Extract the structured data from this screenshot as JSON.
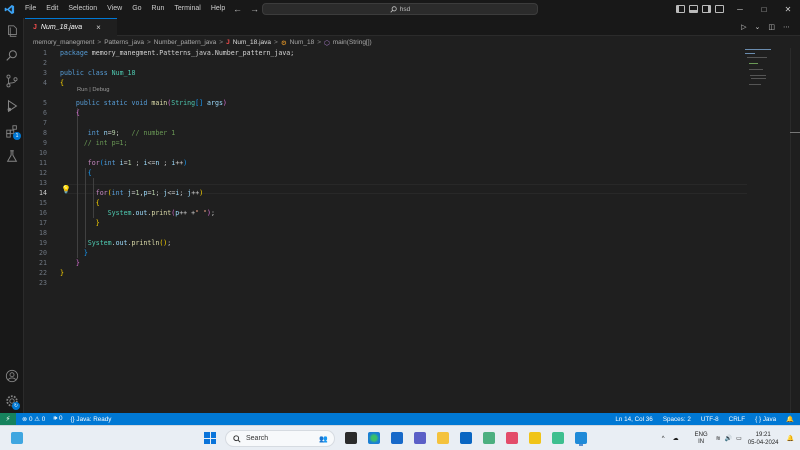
{
  "titlebar": {
    "menu": [
      "File",
      "Edit",
      "Selection",
      "View",
      "Go",
      "Run",
      "Terminal",
      "Help"
    ],
    "search_text": "hsd",
    "icons": {
      "logo": "vscode-logo-icon",
      "back": "arrow-left-icon",
      "forward": "arrow-right-icon",
      "search": "search-icon"
    }
  },
  "tab": {
    "prefix": "J",
    "name": "Num_18.java",
    "close": "×"
  },
  "breadcrumb": {
    "items": [
      "memory_manegment",
      "Patterns_java",
      "Number_pattern_java"
    ],
    "file_prefix": "J",
    "file": "Num_18.java",
    "class": "Num_18",
    "method": "main(String[])",
    "separator": ">"
  },
  "editor": {
    "codelens": "Run | Debug",
    "line_numbers": [
      "1",
      "2",
      "3",
      "4",
      "5",
      "6",
      "7",
      "8",
      "9",
      "10",
      "11",
      "12",
      "13",
      "14",
      "15",
      "16",
      "17",
      "18",
      "19",
      "20",
      "21",
      "22",
      "23"
    ],
    "current_line": 14
  },
  "activitybar": {
    "icons": [
      "explorer-icon",
      "search-icon",
      "source-control-icon",
      "run-debug-icon",
      "extensions-icon",
      "testing-icon",
      "account-icon",
      "settings-icon"
    ],
    "extensions_badge": "1"
  },
  "statusbar": {
    "errors": "0",
    "warnings": "0",
    "ports": "0",
    "java_status": "Java: Ready",
    "cursor": "Ln 14, Col 36",
    "spaces": "Spaces: 2",
    "encoding": "UTF-8",
    "eol": "CRLF",
    "language_braces": "{ }",
    "language": "Java"
  },
  "taskbar": {
    "search_placeholder": "Search",
    "lang_top": "ENG",
    "lang_bottom": "IN",
    "time": "19:21",
    "date": "05-04-2024"
  },
  "colors": {
    "accent": "#0078d4",
    "editor_bg": "#1f1f1f",
    "keyword": "#569cd6",
    "type": "#4ec9b0",
    "comment": "#6a9955"
  }
}
